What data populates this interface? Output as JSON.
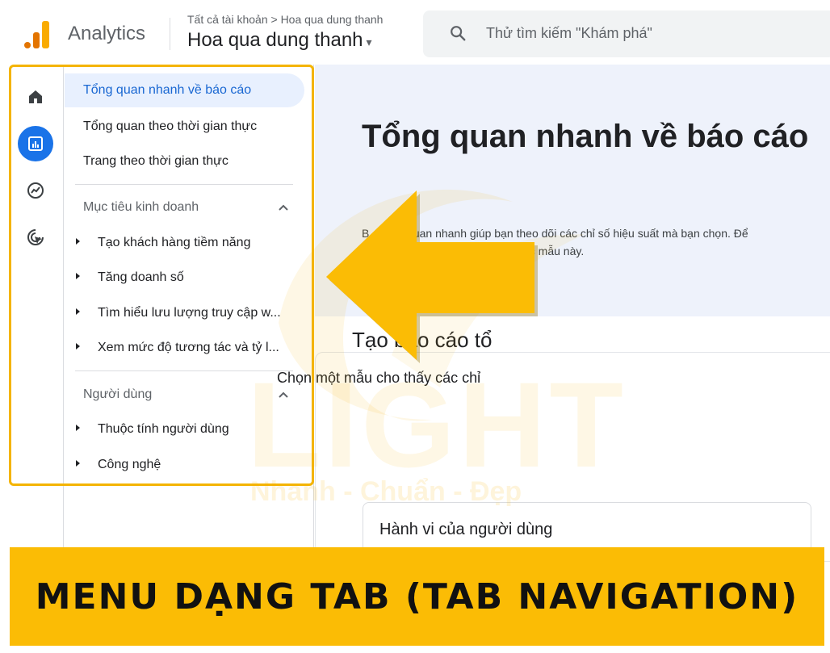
{
  "header": {
    "app_name": "Analytics",
    "breadcrumb": "Tất cả tài khoản > Hoa qua dung thanh",
    "property": "Hoa qua dung thanh",
    "search_placeholder": "Thử tìm kiếm \"Khám phá\""
  },
  "rail": {
    "icons": [
      "home-icon",
      "reports-icon",
      "explore-icon",
      "advertising-icon"
    ],
    "active": "reports-icon"
  },
  "nav": {
    "items": [
      "Tổng quan nhanh về báo cáo",
      "Tổng quan theo thời gian thực",
      "Trang theo thời gian thực"
    ],
    "section1": {
      "title": "Mục tiêu kinh doanh",
      "items": [
        "Tạo khách hàng tiềm năng",
        "Tăng doanh số",
        "Tìm hiểu lưu lượng truy cập w...",
        "Xem mức độ tương tác và tỷ l..."
      ]
    },
    "section2": {
      "title": "Người dùng",
      "items": [
        "Thuộc tính người dùng",
        "Công nghệ"
      ]
    }
  },
  "main": {
    "hero_title": "Tổng quan nhanh về báo cáo",
    "hero_desc_line1": "B... tổng quan nhanh giúp bạn theo dõi các chỉ số hiệu suất mà bạn chọn. Để",
    "hero_desc_line2": "ác mẫu này.",
    "card_title": "Tạo báo cáo tổ",
    "card_sub": "Chọn một mẫu cho thấy các chỉ",
    "template_label": "Hành vi của người dùng"
  },
  "watermark": {
    "brand": "LIGHT",
    "tagline": "Nhanh - Chuẩn - Đẹp"
  },
  "banner": {
    "text": "MENU DẠNG TAB (TAB NAVIGATION)"
  },
  "colors": {
    "accent": "#1a73e8",
    "highlight": "#f4b400",
    "banner": "#fbbc05"
  }
}
